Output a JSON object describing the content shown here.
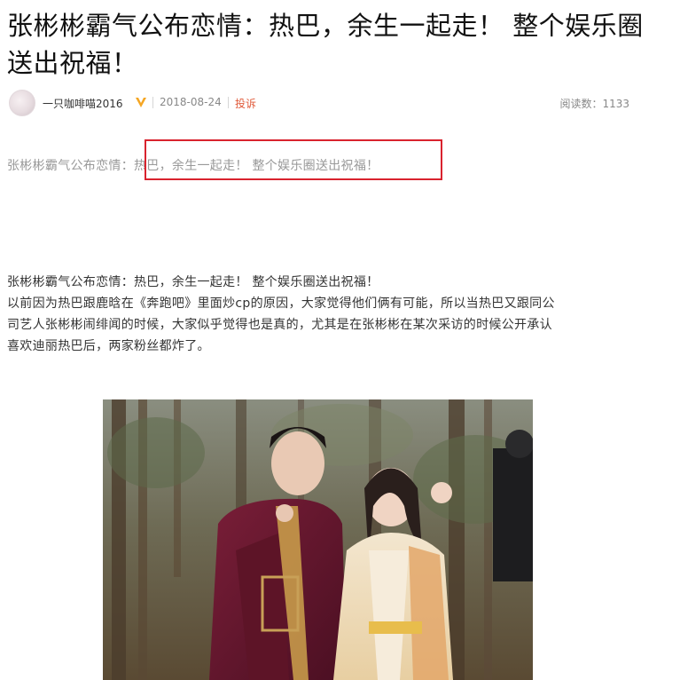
{
  "article": {
    "title": "张彬彬霸气公布恋情：热巴，余生一起走！ 整个娱乐圈送出祝福！",
    "author": "一只咖啡喵2016",
    "date": "2018-08-24",
    "report": "投诉",
    "reads_label": "阅读数：1133",
    "summary": "张彬彬霸气公布恋情：热巴，余生一起走！ 整个娱乐圈送出祝福！",
    "body_lines": [
      "张彬彬霸气公布恋情：热巴，余生一起走！ 整个娱乐圈送出祝福！",
      "以前因为热巴跟鹿晗在《奔跑吧》里面炒cp的原因，大家觉得他们俩有可能，所以当热巴又跟同公",
      "司艺人张彬彬闹绯闻的时候，大家似乎觉得也是真的，尤其是在张彬彬在某次采访的时候公开承认",
      "喜欢迪丽热巴后，两家粉丝都炸了。"
    ]
  },
  "icons": {
    "verified": "verified-v-icon",
    "avatar": "user-avatar"
  },
  "colors": {
    "highlight_border": "#d9232e",
    "report_link": "#e05a3a",
    "verified_badge": "#f5a623"
  }
}
